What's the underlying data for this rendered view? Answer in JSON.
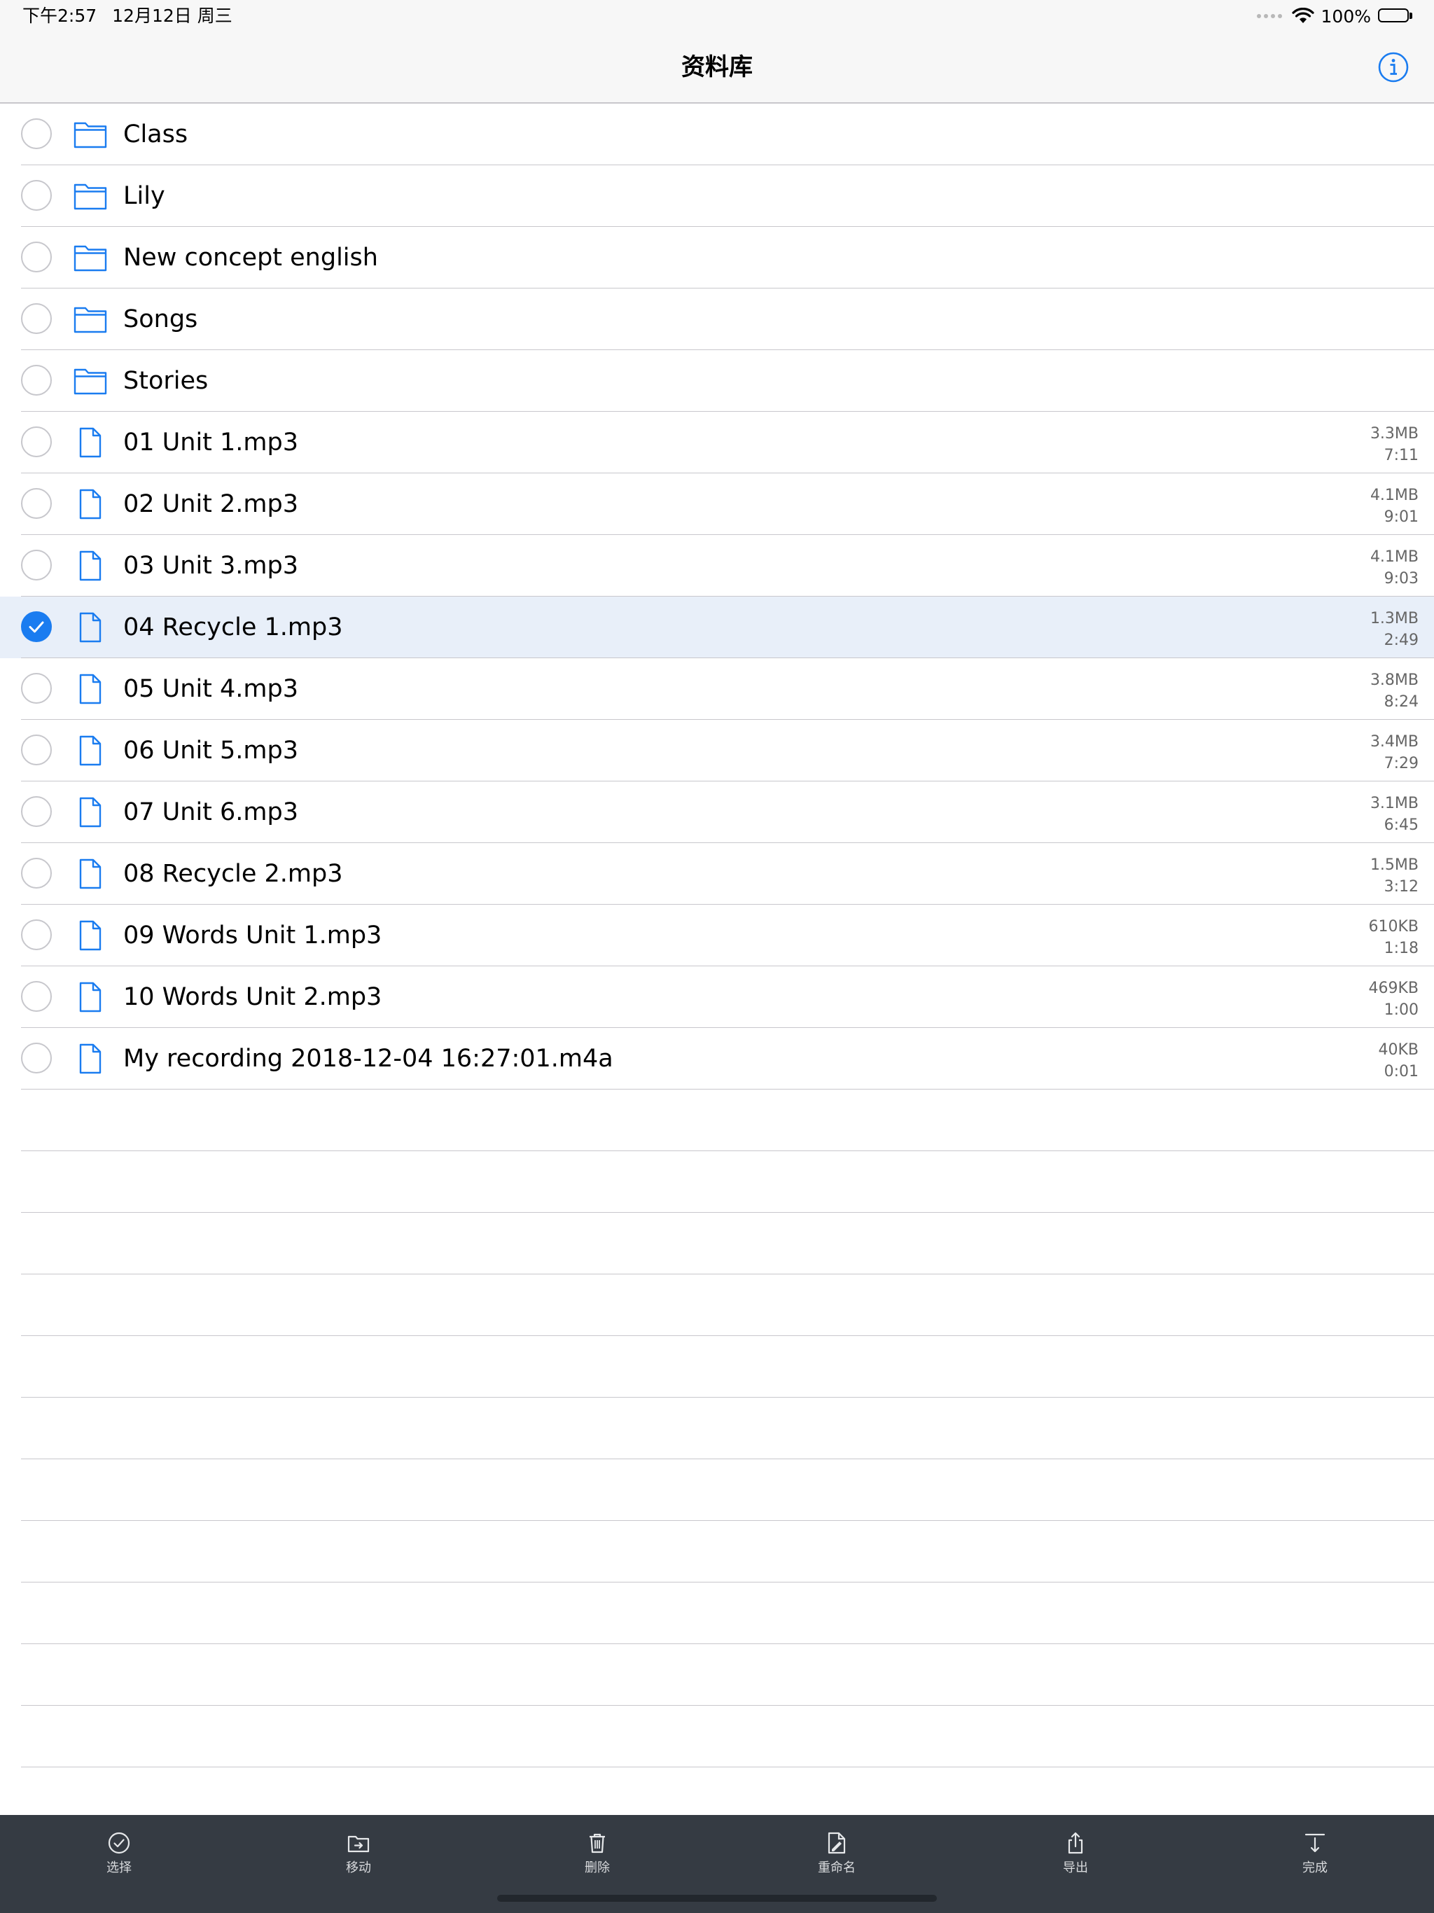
{
  "status_bar": {
    "time": "下午2:57",
    "date": "12月12日 周三",
    "battery": "100%"
  },
  "nav": {
    "title": "资料库"
  },
  "rows": [
    {
      "name": "Class",
      "type": "folder",
      "selected": false
    },
    {
      "name": "Lily",
      "type": "folder",
      "selected": false
    },
    {
      "name": "New concept english",
      "type": "folder",
      "selected": false
    },
    {
      "name": "Songs",
      "type": "folder",
      "selected": false
    },
    {
      "name": "Stories",
      "type": "folder",
      "selected": false
    },
    {
      "name": "01 Unit 1.mp3",
      "type": "file",
      "size": "3.3MB",
      "duration": "7:11",
      "selected": false
    },
    {
      "name": "02 Unit 2.mp3",
      "type": "file",
      "size": "4.1MB",
      "duration": "9:01",
      "selected": false
    },
    {
      "name": "03 Unit 3.mp3",
      "type": "file",
      "size": "4.1MB",
      "duration": "9:03",
      "selected": false
    },
    {
      "name": "04 Recycle 1.mp3",
      "type": "file",
      "size": "1.3MB",
      "duration": "2:49",
      "selected": true
    },
    {
      "name": "05 Unit 4.mp3",
      "type": "file",
      "size": "3.8MB",
      "duration": "8:24",
      "selected": false
    },
    {
      "name": "06 Unit 5.mp3",
      "type": "file",
      "size": "3.4MB",
      "duration": "7:29",
      "selected": false
    },
    {
      "name": "07 Unit 6.mp3",
      "type": "file",
      "size": "3.1MB",
      "duration": "6:45",
      "selected": false
    },
    {
      "name": "08 Recycle 2.mp3",
      "type": "file",
      "size": "1.5MB",
      "duration": "3:12",
      "selected": false
    },
    {
      "name": "09 Words Unit 1.mp3",
      "type": "file",
      "size": "610KB",
      "duration": "1:18",
      "selected": false
    },
    {
      "name": "10 Words Unit 2.mp3",
      "type": "file",
      "size": "469KB",
      "duration": "1:00",
      "selected": false
    },
    {
      "name": "My recording 2018-12-04 16:27:01.m4a",
      "type": "file",
      "size": "40KB",
      "duration": "0:01",
      "selected": false
    }
  ],
  "toolbar": {
    "select": "选择",
    "move": "移动",
    "delete": "删除",
    "rename": "重命名",
    "export": "导出",
    "done": "完成"
  },
  "colors": {
    "accent": "#1a7cf0",
    "selected_row": "#e8eff9",
    "toolbar_bg": "#353b43"
  }
}
